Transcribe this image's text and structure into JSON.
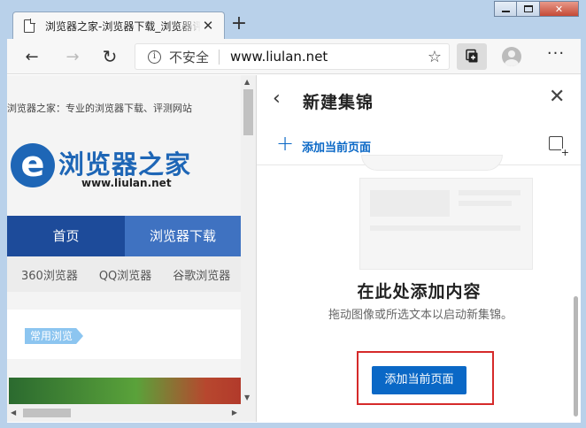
{
  "tab": {
    "title": "浏览器之家-浏览器下载_浏览器评测网站",
    "close": "✕",
    "new_tab": "+"
  },
  "window": {
    "close": "✕"
  },
  "toolbar": {
    "back": "←",
    "forward": "→",
    "refresh": "↻",
    "security_label": "不安全",
    "url": "www.liulan.net",
    "favorite": "☆",
    "more": "···"
  },
  "webpage": {
    "site_description": "浏览器之家：专业的浏览器下载、评测网站",
    "logo_letter": "e",
    "logo_text": "浏览器之家",
    "logo_url": "www.liulan.net",
    "nav": [
      "首页",
      "浏览器下载"
    ],
    "sub_nav": [
      "360浏览器",
      "QQ浏览器",
      "谷歌浏览器"
    ],
    "tag": "常用浏览"
  },
  "pane": {
    "back": "‹",
    "title": "新建集锦",
    "close": "✕",
    "add_current_page": "添加当前页面",
    "empty_title": "在此处添加内容",
    "empty_description": "拖动图像或所选文本以启动新集锦。",
    "primary_button": "添加当前页面"
  },
  "colors": {
    "accent": "#0a68c6",
    "highlight": "#d52a2a",
    "nav_primary": "#1d4b9a",
    "nav_secondary": "#3f72c1"
  }
}
